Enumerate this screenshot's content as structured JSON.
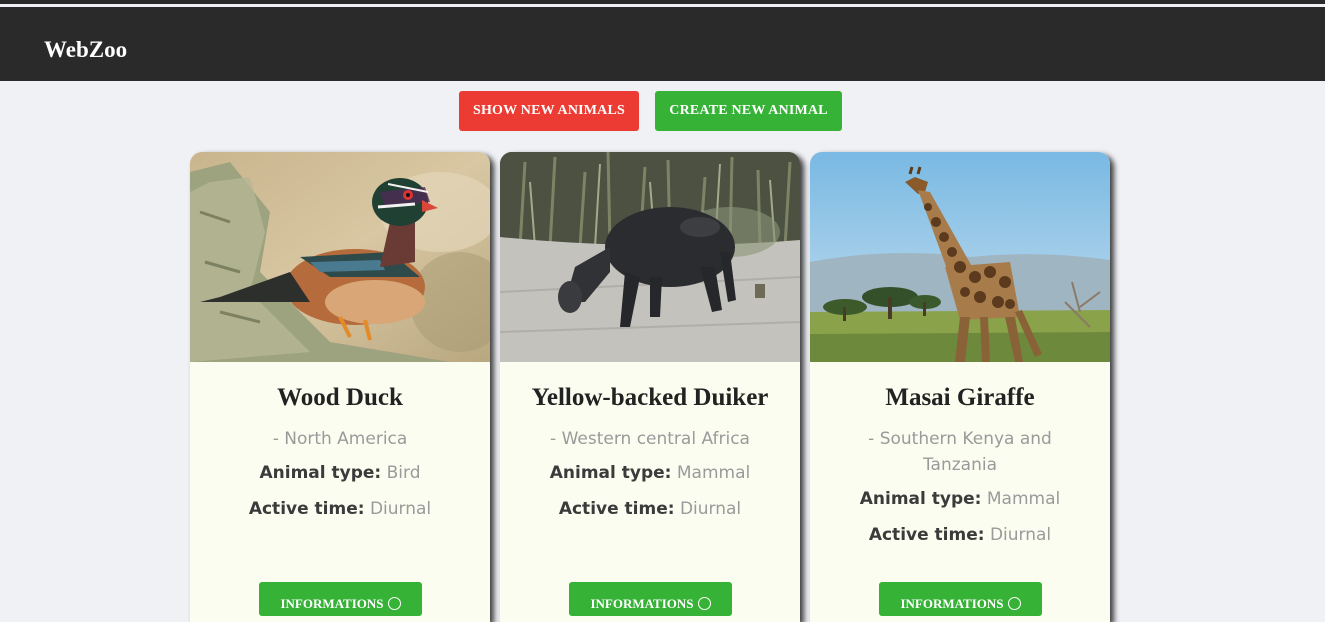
{
  "app": {
    "brand": "WebZoo"
  },
  "actions": {
    "show_new": "SHOW NEW ANIMALS",
    "create_new": "CREATE NEW ANIMAL"
  },
  "labels": {
    "animal_type": "Animal type:",
    "active_time": "Active time:",
    "info_button": "INFORMATIONS"
  },
  "animals": [
    {
      "name": "Wood Duck",
      "origin": "- North America",
      "type": "Bird",
      "active": "Diurnal"
    },
    {
      "name": "Yellow-backed Duiker",
      "origin": "- Western central Africa",
      "type": "Mammal",
      "active": "Diurnal"
    },
    {
      "name": "Masai Giraffe",
      "origin": "- Southern Kenya and Tanzania",
      "type": "Mammal",
      "active": "Diurnal"
    }
  ],
  "colors": {
    "navbar": "#2a2a2a",
    "accent_red": "#ec3b32",
    "accent_green": "#36b237",
    "card_bg": "#fcfdf1",
    "page_bg": "#f0f1f5"
  }
}
